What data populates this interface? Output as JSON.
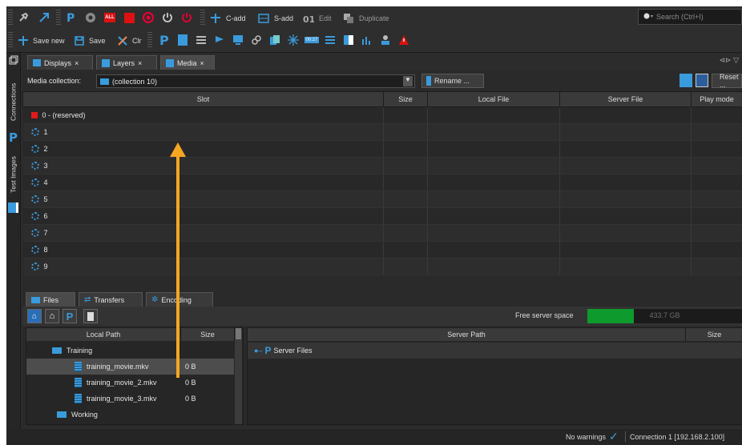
{
  "toolbar1": {
    "c_add": "C-add",
    "s_add": "S-add",
    "edit": "Edit",
    "duplicate": "Duplicate",
    "search_placeholder": "Search (Ctrl+I)",
    "all_badge": "ALL"
  },
  "toolbar2": {
    "save_new": "Save new",
    "save": "Save",
    "clr": "Clr",
    "time_badge": "00:27"
  },
  "sidebar": {
    "connections": "Connections",
    "test_images": "Test Images"
  },
  "tabs": [
    {
      "label": "Displays"
    },
    {
      "label": "Layers"
    },
    {
      "label": "Media"
    }
  ],
  "media": {
    "collection_label": "Media collection:",
    "collection_value": "(collection 10)",
    "rename_label": "Rename ...",
    "reset_label": "Reset ...",
    "columns": [
      "Slot",
      "Size",
      "Local File",
      "Server File",
      "Play mode"
    ],
    "slots": [
      "0 - (reserved)",
      "1",
      "2",
      "3",
      "4",
      "5",
      "6",
      "7",
      "8",
      "9"
    ]
  },
  "bottom": {
    "tabs": [
      "Files",
      "Transfers",
      "Encoding"
    ],
    "free_space_label": "Free server space",
    "free_space_value": "433.7 GB",
    "free_space_fraction": 0.3,
    "left_columns": [
      "Local Path",
      "Size"
    ],
    "right_columns": [
      "Server Path",
      "Size"
    ],
    "local_tree": [
      {
        "name": "Training",
        "size": ""
      },
      {
        "name": "training_movie.mkv",
        "size": "0 B"
      },
      {
        "name": "training_movie_2.mkv",
        "size": "0 B"
      },
      {
        "name": "training_movie_3.mkv",
        "size": "0 B"
      },
      {
        "name": "Working",
        "size": ""
      }
    ],
    "server_root": "Server Files"
  },
  "status": {
    "warnings": "No warnings",
    "connection": "Connection 1 [192.168.2.100]"
  },
  "colors": {
    "accent_orange": "#f5a623",
    "reserved_red": "#e01b1b",
    "progress_green": "#0e9a2c",
    "icon_blue": "#3a9bdc"
  }
}
